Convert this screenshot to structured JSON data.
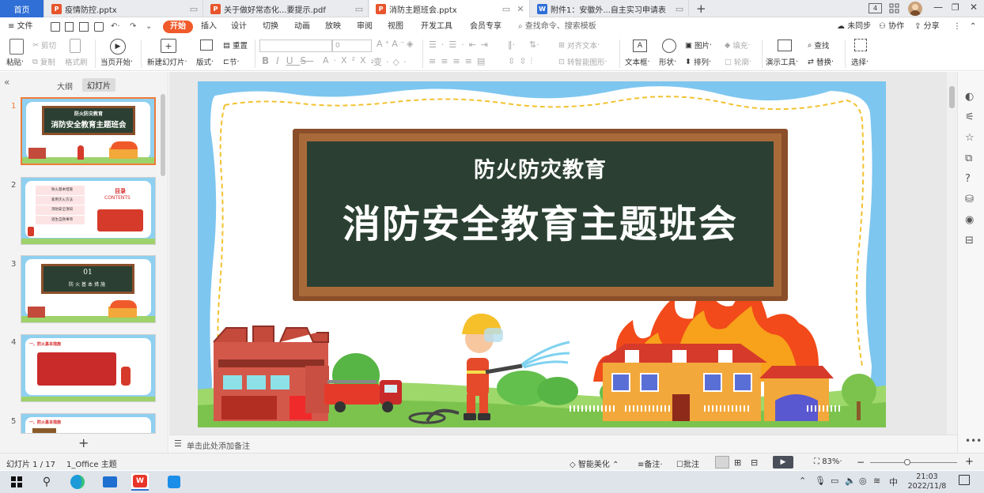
{
  "tabs": [
    {
      "label": "首页"
    },
    {
      "label": "疫情防控.pptx",
      "icon": "P"
    },
    {
      "label": "关于做好常态化...要提示.pdf",
      "icon": "P"
    },
    {
      "label": "消防主题班会.pptx",
      "icon": "P"
    },
    {
      "label": "附件1：安徽外...自主实习申请表",
      "icon": "W"
    }
  ],
  "tabbar_right": {
    "badge": "4"
  },
  "menu": {
    "file": "文件",
    "start": "开始",
    "insert": "插入",
    "design": "设计",
    "transition": "切换",
    "animation": "动画",
    "slideshow": "放映",
    "review": "审阅",
    "view": "视图",
    "developer": "开发工具",
    "member": "会员专享",
    "search_placeholder": "查找命令、搜索模板",
    "sync": "未同步",
    "collab": "协作",
    "share": "分享"
  },
  "ribbon": {
    "paste": "粘贴",
    "cut": "剪切",
    "copy": "复制",
    "format_painter": "格式刷",
    "play_from_current": "当页开始",
    "new_slide": "新建幻灯片",
    "layout": "版式",
    "reset": "重置",
    "section": "节",
    "font_size": "0",
    "align_text": "对齐文本",
    "smart_art": "转智能图形",
    "textbox": "文本框",
    "shape": "形状",
    "picture": "图片",
    "arrange": "排列",
    "fill": "填充",
    "outline": "轮廓",
    "present_tool": "演示工具",
    "find": "查找",
    "replace": "替换",
    "select": "选择"
  },
  "left_panel": {
    "tab_outline": "大纲",
    "tab_slides": "幻灯片",
    "slide_numbers": [
      "1",
      "2",
      "3",
      "4",
      "5"
    ],
    "thumb1_line1": "防火防灾教育",
    "thumb1_line2": "消防安全教育主题班会",
    "thumb2_title": "目录",
    "thumb2_sub": "CONTENTS",
    "thumb2_items": [
      "防火基本措施",
      "家用灭火方法",
      "消防安全须知",
      "逃生自救事项"
    ],
    "thumb3_num": "01",
    "thumb3_text": "防火基本措施",
    "thumb4_head": "一、防火基本措施",
    "thumb5_head": "一、防火基本措施"
  },
  "slide": {
    "title_small": "防火防灾教育",
    "title_big": "消防安全教育主题班会"
  },
  "notes_placeholder": "单击此处添加备注",
  "status": {
    "slide_index": "幻灯片 1 / 17",
    "theme": "1_Office 主题",
    "beautify": "智能美化",
    "notes": "备注",
    "comment": "批注",
    "zoom": "83%"
  },
  "taskbar": {
    "time": "21:03",
    "date": "2022/11/8",
    "ime": "中"
  },
  "colors": {
    "accent": "#f05a2a",
    "home_tab": "#2f6fd6",
    "board": "#2b4032",
    "frame": "#8a4f2a",
    "sky": "#7dc6ef"
  }
}
